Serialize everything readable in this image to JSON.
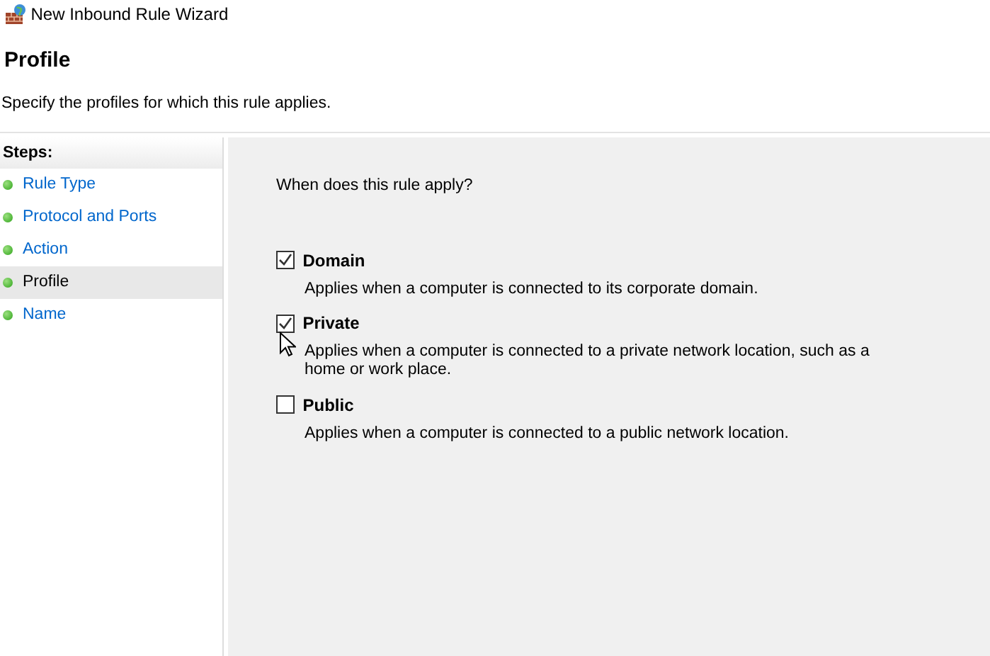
{
  "window": {
    "title": "New Inbound Rule Wizard"
  },
  "header": {
    "title": "Profile",
    "subtitle": "Specify the profiles for which this rule applies."
  },
  "steps": {
    "heading": "Steps:",
    "items": [
      {
        "label": "Rule Type",
        "selected": false
      },
      {
        "label": "Protocol and Ports",
        "selected": false
      },
      {
        "label": "Action",
        "selected": false
      },
      {
        "label": "Profile",
        "selected": true
      },
      {
        "label": "Name",
        "selected": false
      }
    ]
  },
  "question": "When does this rule apply?",
  "profiles": [
    {
      "label": "Domain",
      "checked": true,
      "description": "Applies when a computer is connected to its corporate domain."
    },
    {
      "label": "Private",
      "checked": true,
      "description": "Applies when a computer is connected to a private network location, such as a home or work place."
    },
    {
      "label": "Public",
      "checked": false,
      "description": "Applies when a computer is connected to a public network location."
    }
  ]
}
